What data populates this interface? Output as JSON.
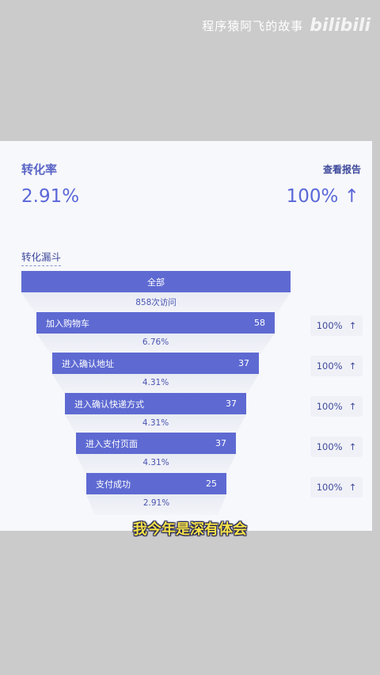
{
  "watermark": {
    "channel": "程序猿阿飞的故事",
    "logo": "bilibili"
  },
  "card": {
    "title": "转化率",
    "report_link": "查看报告",
    "rate": "2.91%",
    "compare": "100% ↑",
    "funnel_title": "转化漏斗"
  },
  "funnel": {
    "steps": [
      {
        "label": "全部",
        "value": ""
      },
      {
        "label": "加入购物车",
        "value": "58"
      },
      {
        "label": "进入确认地址",
        "value": "37"
      },
      {
        "label": "进入确认快递方式",
        "value": "37"
      },
      {
        "label": "进入支付页面",
        "value": "37"
      },
      {
        "label": "支付成功",
        "value": "25"
      }
    ],
    "rates": [
      "858次访问",
      "6.76%",
      "4.31%",
      "4.31%",
      "4.31%",
      "2.91%"
    ],
    "compare_chips": [
      {
        "value": "100%",
        "arrow": "↑"
      },
      {
        "value": "100%",
        "arrow": "↑"
      },
      {
        "value": "100%",
        "arrow": "↑"
      },
      {
        "value": "100%",
        "arrow": "↑"
      },
      {
        "value": "100%",
        "arrow": "↑"
      }
    ]
  },
  "subtitle": "我今年是深有体会"
}
